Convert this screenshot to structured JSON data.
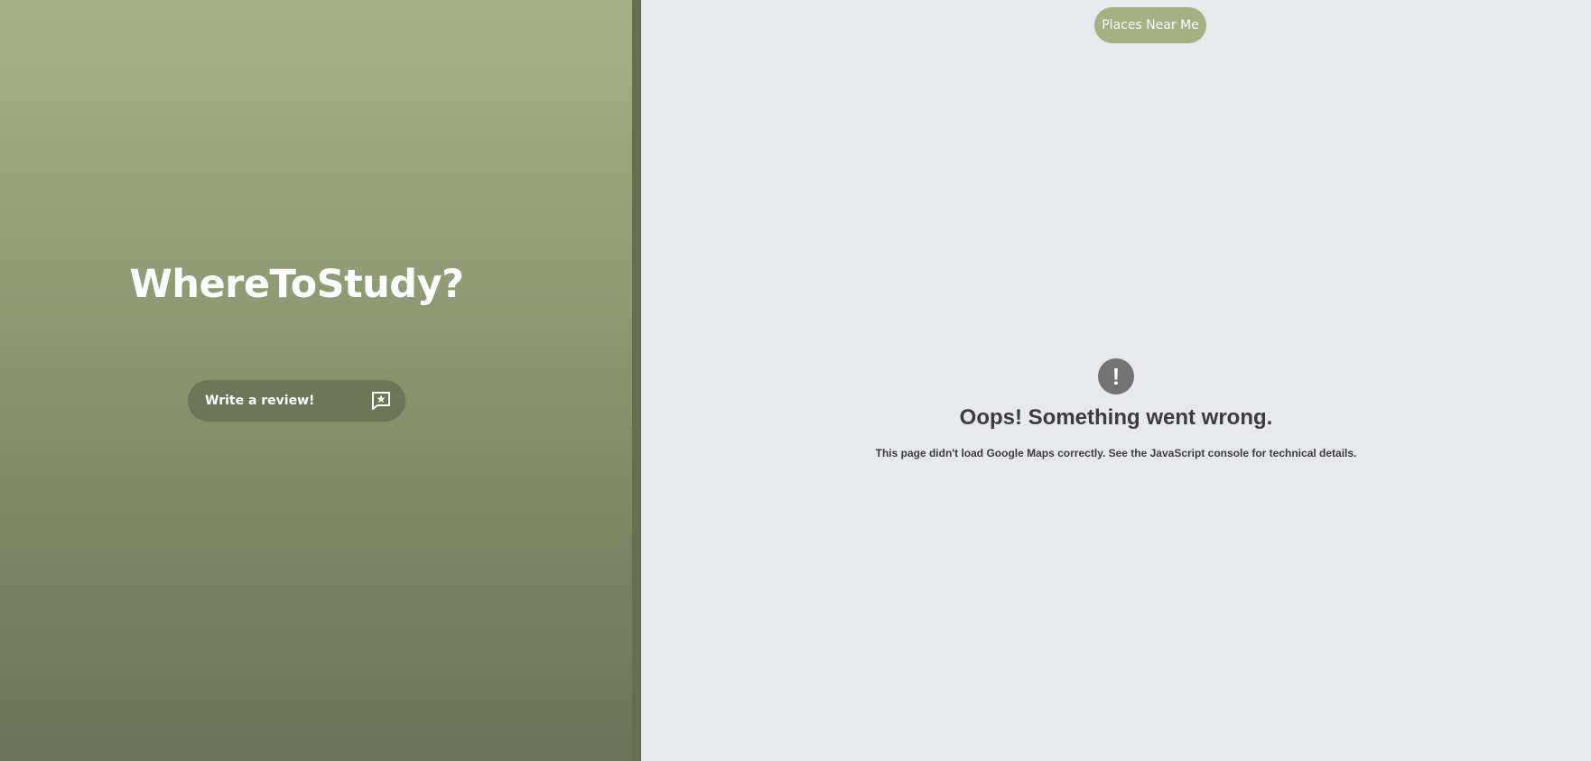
{
  "sidebar": {
    "title": "WhereToStudy?",
    "review_button": {
      "label": "Write a review!",
      "icon": "review-star-icon"
    }
  },
  "map": {
    "places_button_label": "Places Near Me",
    "error": {
      "icon": "exclamation-icon",
      "icon_glyph": "!",
      "title": "Oops! Something went wrong.",
      "message": "This page didn't load Google Maps correctly. See the JavaScript console for technical details."
    }
  },
  "colors": {
    "sidebar_top": "#a6b286",
    "sidebar_bottom": "#677556",
    "divider": "#63704f",
    "map_background": "#e8e9ed",
    "places_button": "#a5b083",
    "error_icon": "#737373",
    "error_text": "#3c3c3c"
  }
}
